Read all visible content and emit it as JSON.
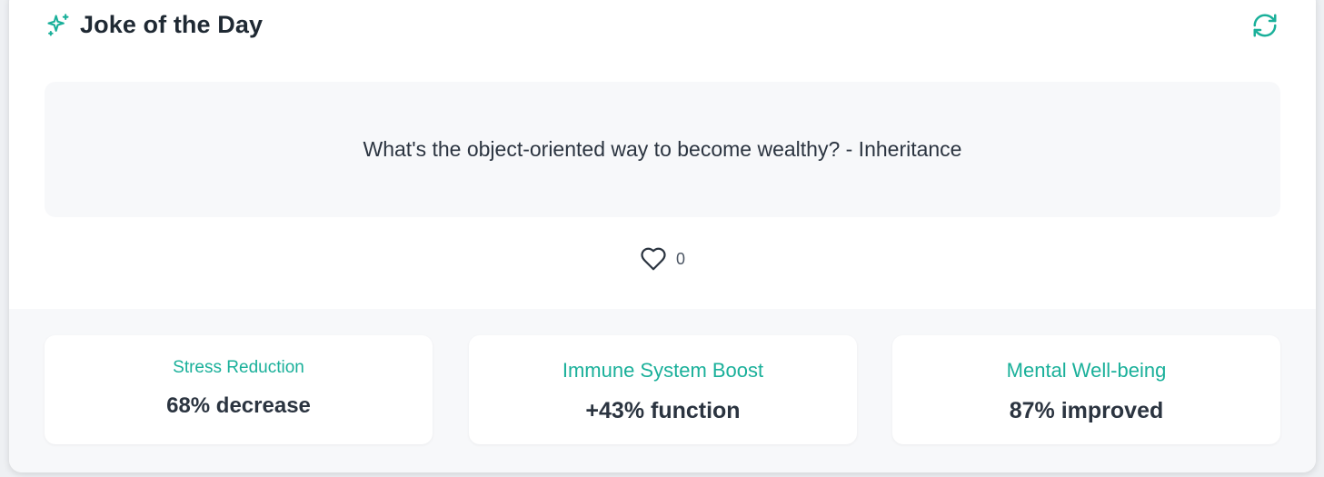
{
  "header": {
    "title": "Joke of the Day",
    "title_icon": "sparkles-icon",
    "refresh_icon": "refresh-icon"
  },
  "joke": {
    "text": "What's the object-oriented way to become wealthy? - Inheritance"
  },
  "likes": {
    "icon": "heart-icon",
    "count": "0"
  },
  "stats": [
    {
      "label": "Stress Reduction",
      "value": "68% decrease"
    },
    {
      "label": "Immune System Boost",
      "value": "+43% function"
    },
    {
      "label": "Mental Well-being",
      "value": "87% improved"
    }
  ],
  "colors": {
    "accent": "#1ab09a",
    "text_dark": "#1f2933",
    "panel_bg": "#f7f8fa"
  }
}
